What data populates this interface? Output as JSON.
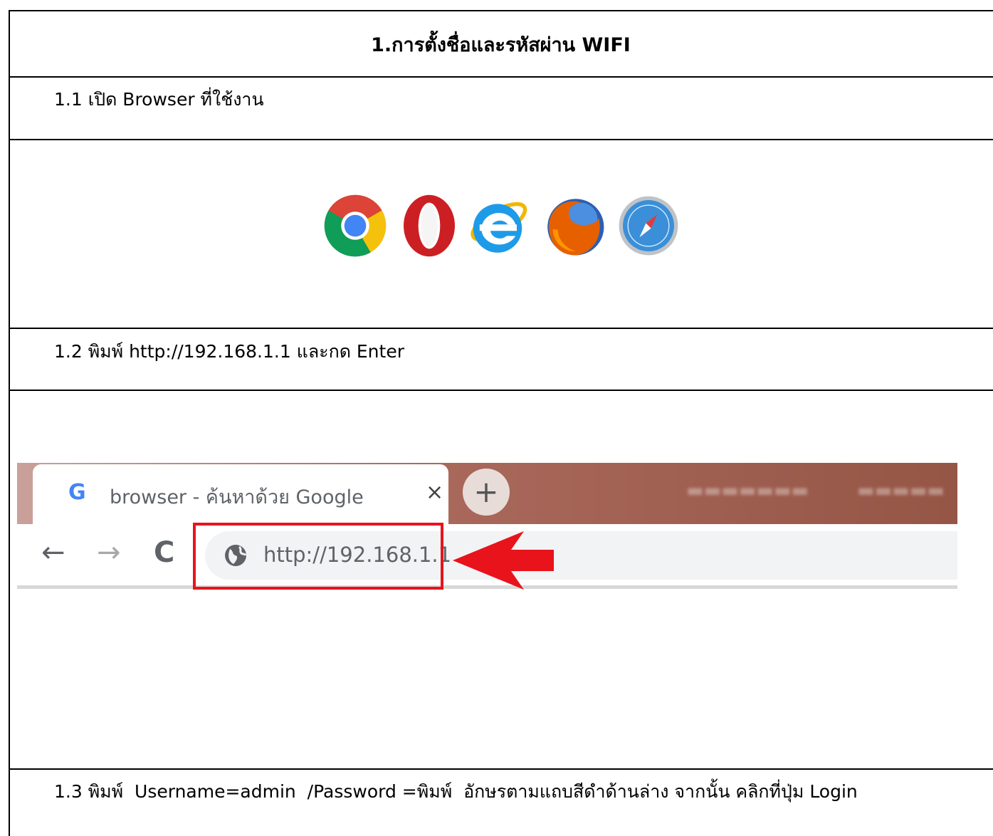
{
  "title": "1.การตั้งชื่อและรหัสผ่าน WIFI",
  "steps": {
    "s1": "1.1 เปิด Browser ที่ใช้งาน",
    "s2": "1.2 พิมพ์ http://192.168.1.1 และกด Enter",
    "s3": "1.3 พิมพ์  Username=admin  /Password =พิมพ์  อักษรตามแถบสีดำด้านล่าง จากนั้น คลิกที่ปุ่ม Login"
  },
  "logos": [
    "chrome-icon",
    "opera-icon",
    "internet-explorer-icon",
    "firefox-icon",
    "safari-icon"
  ],
  "browser": {
    "tab_title": "browser - ค้นหาด้วย Google",
    "tab_icon": "G",
    "close_icon": "×",
    "new_tab_icon": "+",
    "back_icon": "←",
    "forward_icon": "→",
    "reload_icon": "C",
    "url": "http://192.168.1.1"
  },
  "colors": {
    "highlight": "#e8131b",
    "tabbar": "#a9685b"
  }
}
